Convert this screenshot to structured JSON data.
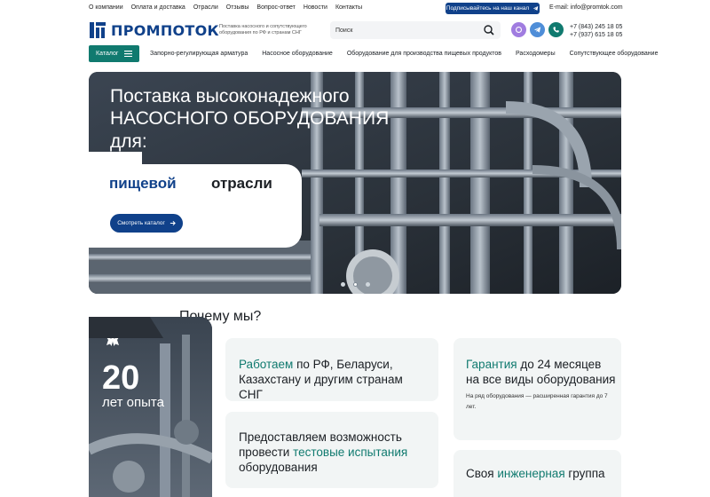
{
  "topnav": [
    "О компании",
    "Оплата и доставка",
    "Отрасли",
    "Отзывы",
    "Вопрос-ответ",
    "Новости",
    "Контакты"
  ],
  "subscribe_label": "Подписывайтесь на наш канал",
  "email": "E-mail: info@promtok.com",
  "logo_text": "ПРОМПОТОК",
  "tagline": "Поставка насосного и сопутствующего оборудования по РФ и странам СНГ",
  "search": {
    "placeholder": "Поиск"
  },
  "phones": [
    "+7 (843) 245 18 05",
    "+7 (937) 615 18 05"
  ],
  "catalog_label": "Каталог",
  "mainnav": [
    "Запорно-регулирующая арматура",
    "Насосное оборудование",
    "Оборудование для производства пищевых продуктов",
    "Расходомеры",
    "Сопутствующее оборудование"
  ],
  "hero": {
    "line1": "Поставка высоконадежного",
    "line2": "НАСОСНОГО ОБОРУДОВАНИЯ",
    "line3": "для:",
    "word1": "пищевой",
    "word2": "отрасли",
    "cta": "Смотреть каталог",
    "slides": 3,
    "active_slide": 1
  },
  "why": {
    "title": "Почему мы?",
    "years_num": "20",
    "years_label": "лет опыта",
    "card1": {
      "accent": "Работаем",
      "rest": " по РФ, Беларуси, Казахстану и другим странам СНГ"
    },
    "card2": {
      "accent": "Гарантия",
      "rest": " до 24 месяцев на все виды оборудования",
      "small": "На ряд оборудования — расширенная гарантия до 7 лет."
    },
    "card3": {
      "lead": "Предоставляем возможность провести ",
      "accent": "тестовые испытания",
      "rest": " оборудования"
    },
    "card4": {
      "lead": "Своя ",
      "accent": "инженерная",
      "rest": " группа"
    }
  },
  "colors": {
    "brand_blue": "#10418a",
    "brand_green": "#107a6f",
    "card_bg": "#f2f5f5"
  }
}
